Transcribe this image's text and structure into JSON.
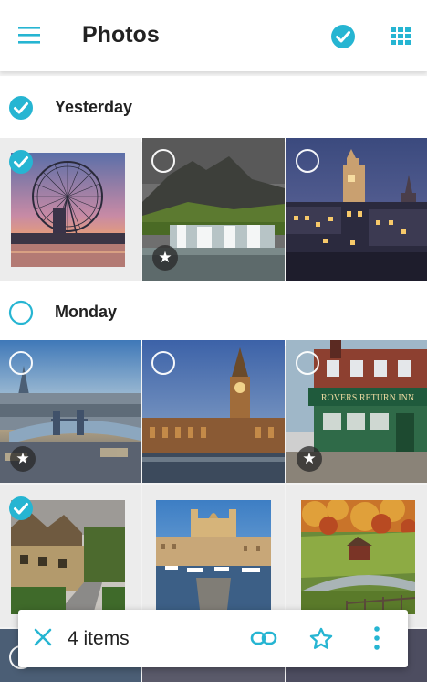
{
  "colors": {
    "accent": "#26b5d2",
    "header_bg": "#ffffff",
    "selected_bg": "#ececec"
  },
  "appbar": {
    "title": "Photos",
    "menu_icon": "hamburger-menu-icon",
    "select_icon": "check-circle-icon",
    "grid_icon": "grid-view-icon"
  },
  "sections": [
    {
      "label": "Yesterday",
      "selected": true
    },
    {
      "label": "Monday",
      "selected": false
    }
  ],
  "photos": [
    {
      "subject": "london-eye",
      "selected": true,
      "starred": false
    },
    {
      "subject": "mountain-waterfall",
      "selected": false,
      "starred": true
    },
    {
      "subject": "edinburgh-night",
      "selected": false,
      "starred": false
    },
    {
      "subject": "london-tower-bridge",
      "selected": false,
      "starred": true
    },
    {
      "subject": "big-ben",
      "selected": false,
      "starred": false
    },
    {
      "subject": "rovers-return-inn",
      "selected": false,
      "starred": true
    },
    {
      "subject": "cotswolds-cottages",
      "selected": true,
      "starred": false
    },
    {
      "subject": "valletta-harbour",
      "selected": false,
      "starred": false
    },
    {
      "subject": "autumn-farm",
      "selected": false,
      "starred": false
    }
  ],
  "pub_sign": "ROVERS RETURN INN",
  "action_bar": {
    "count_label": "4 items",
    "close_icon": "close-icon",
    "link_icon": "link-icon",
    "star_icon": "star-outline-icon",
    "more_icon": "more-vert-icon"
  }
}
